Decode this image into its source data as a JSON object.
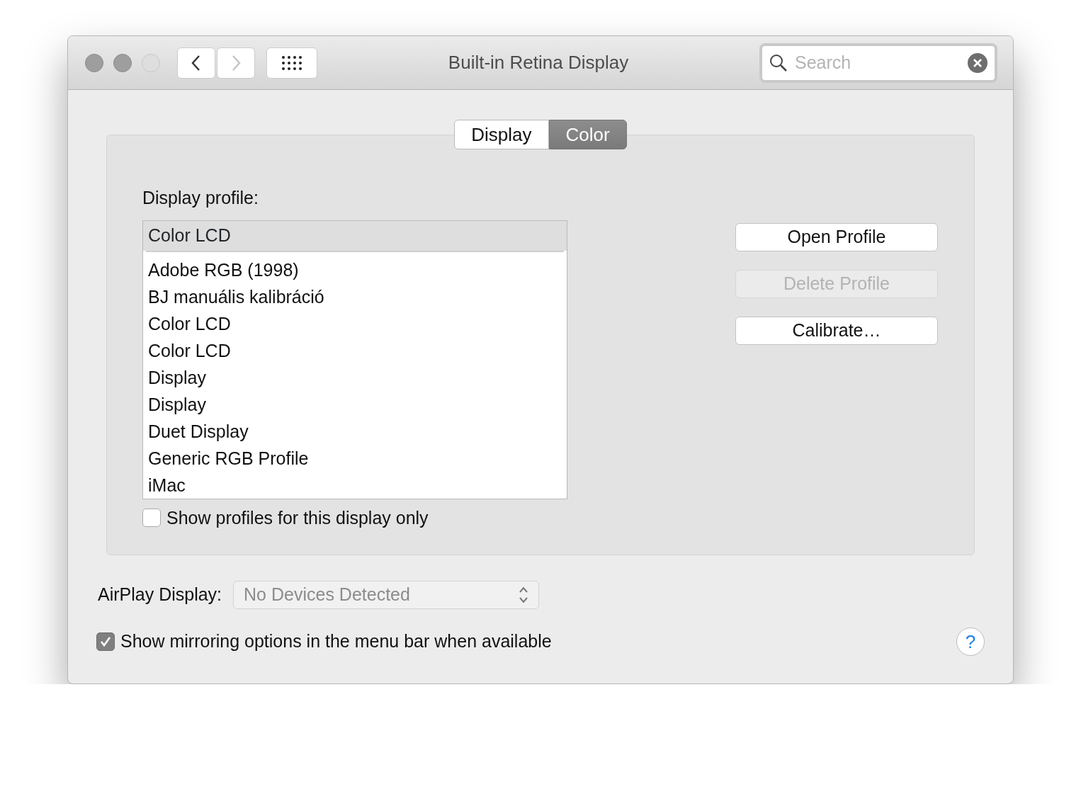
{
  "window": {
    "title": "Built-in Retina Display",
    "traffic_lights": [
      {
        "disabled": false
      },
      {
        "disabled": false
      },
      {
        "disabled": true
      }
    ],
    "nav_buttons": [
      {
        "kind": "back",
        "disabled": false
      },
      {
        "kind": "forward",
        "disabled": true
      }
    ],
    "search": {
      "placeholder": "Search"
    }
  },
  "tabs": [
    {
      "label": "Display",
      "selected": false
    },
    {
      "label": "Color",
      "selected": true
    }
  ],
  "profile": {
    "label": "Display profile:",
    "current": "Color LCD",
    "items": [
      "Adobe RGB (1998)",
      "BJ manuális kalibráció",
      "Color LCD",
      "Color LCD",
      "Display",
      "Display",
      "Duet Display",
      "Generic RGB Profile",
      "iMac"
    ],
    "checkbox": {
      "label": "Show profiles for this display only",
      "checked": false
    }
  },
  "buttons": [
    {
      "label": "Open Profile",
      "disabled": false
    },
    {
      "label": "Delete Profile",
      "disabled": true
    },
    {
      "label": "Calibrate…",
      "disabled": false
    }
  ],
  "airplay": {
    "label": "AirPlay Display:",
    "value": "No Devices Detected"
  },
  "mirroring": {
    "label": "Show mirroring options in the menu bar when available",
    "checked": true
  },
  "help": {
    "label": "?"
  }
}
